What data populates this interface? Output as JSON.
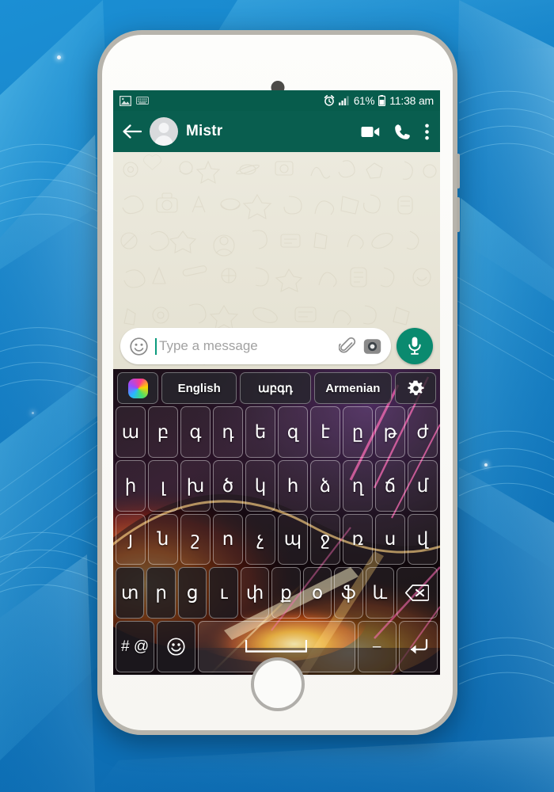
{
  "statusbar": {
    "left_icons": [
      "image-notification-icon",
      "keyboard-icon"
    ],
    "alarm_icon": "alarm-clock-icon",
    "signal_icon": "signal-bars-icon",
    "battery_percent": "61%",
    "battery_icon": "battery-icon",
    "time": "11:38 am"
  },
  "appbar": {
    "back_icon": "back-arrow-icon",
    "avatar": "contact-avatar",
    "contact_name": "Mistr",
    "actions": [
      "video-call-icon",
      "voice-call-icon",
      "overflow-menu-icon"
    ]
  },
  "chat": {
    "wallpaper": "whatsapp-doodle-wallpaper"
  },
  "input": {
    "emoji_icon": "emoji-icon",
    "placeholder": "Type a message",
    "value": "",
    "attach_icon": "paperclip-icon",
    "camera_icon": "camera-icon",
    "mic_icon": "microphone-icon"
  },
  "keyboard": {
    "toolbar": {
      "theme_icon": "theme-color-wheel-icon",
      "english_label": "English",
      "native_label": "աբգդ",
      "armenian_label": "Armenian",
      "settings_icon": "gear-icon"
    },
    "rows": [
      [
        "ա",
        "բ",
        "գ",
        "դ",
        "ե",
        "զ",
        "է",
        "ը",
        "թ",
        "ժ"
      ],
      [
        "ի",
        "լ",
        "խ",
        "ծ",
        "կ",
        "հ",
        "ձ",
        "ղ",
        "ճ",
        "մ"
      ],
      [
        "յ",
        "ն",
        "շ",
        "ո",
        "չ",
        "պ",
        "ջ",
        "ռ",
        "ս",
        "վ"
      ],
      [
        "տ",
        "ր",
        "ց",
        "ւ",
        "փ",
        "ք",
        "օ",
        "ֆ",
        "և"
      ]
    ],
    "backspace_icon": "backspace-icon",
    "bottom_row": {
      "symbols_label": "# @",
      "emoji_icon": "emoji-icon",
      "space_icon": "spacebar-icon",
      "dash_label": "–",
      "enter_icon": "enter-icon"
    }
  },
  "colors": {
    "whatsapp_header": "#095e4f",
    "whatsapp_statusbar": "#075c4c",
    "mic_green": "#0a8a6f",
    "background_blue": "#1580c6",
    "chat_wallpaper": "#e8e5d7"
  }
}
